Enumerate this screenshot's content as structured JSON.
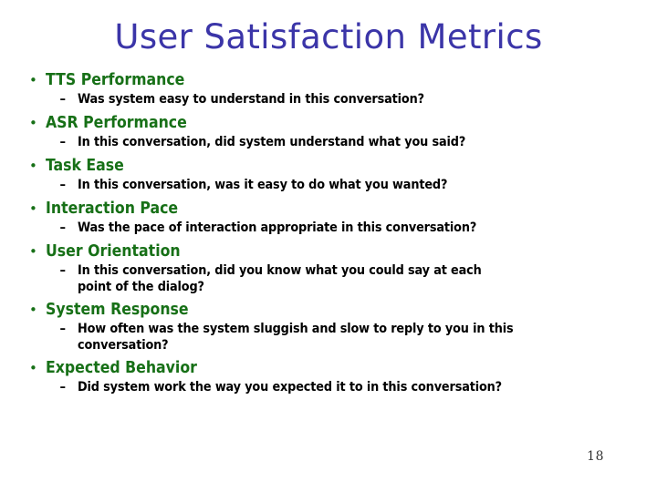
{
  "slide": {
    "title": "User Satisfaction Metrics",
    "page_number": "18",
    "colors": {
      "background": "#ffffff",
      "title": "#3b35a8",
      "heading": "#177017",
      "body": "#000000",
      "page_number": "#333333"
    },
    "level1_marker": "•",
    "level2_marker": "–",
    "items": [
      {
        "heading": "TTS Performance",
        "question_lines": [
          "Was system easy to understand in this conversation?"
        ]
      },
      {
        "heading": "ASR Performance",
        "question_lines": [
          "In this conversation, did system understand what you said?"
        ]
      },
      {
        "heading": "Task Ease",
        "question_lines": [
          "In this conversation, was it easy to do what you wanted?"
        ]
      },
      {
        "heading": "Interaction Pace",
        "question_lines": [
          "Was the pace of interaction appropriate in this conversation?"
        ]
      },
      {
        "heading": "User Orientation",
        "question_lines": [
          "In this conversation, did you know what you could say at each",
          "point of the dialog?"
        ]
      },
      {
        "heading": "System Response",
        "question_lines": [
          "How often was the system sluggish and slow to reply to you in this",
          "conversation?"
        ]
      },
      {
        "heading": "Expected Behavior",
        "question_lines": [
          "Did system work the way you expected it to in this conversation?"
        ]
      }
    ]
  }
}
